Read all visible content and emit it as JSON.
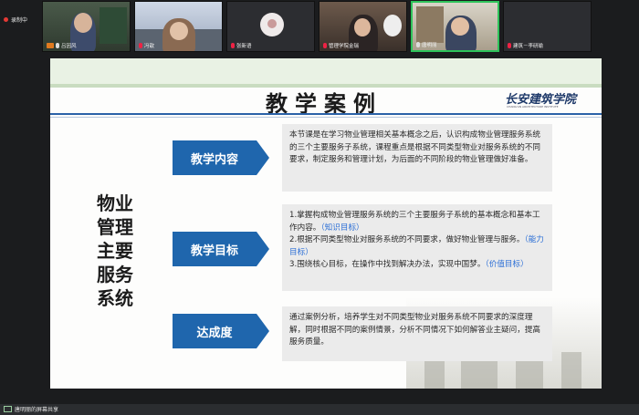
{
  "app": {
    "recording_label": "录制中",
    "screen_share_label": "唐明丽的屏幕共享"
  },
  "participants": [
    {
      "name": "吕因风",
      "mic": "on"
    },
    {
      "name": "冯歆",
      "mic": "muted"
    },
    {
      "name": "张新语",
      "mic": "muted"
    },
    {
      "name": "管理学院金瑞",
      "mic": "muted"
    },
    {
      "name": "唐明丽",
      "mic": "on",
      "active": true
    },
    {
      "name": "建筑－李研瑜",
      "mic": "muted"
    }
  ],
  "slide": {
    "title": "教学案例",
    "logo_text": "长安建筑学院",
    "logo_subtext": "CHANG'AN ARCHITECTURE INSTITUTE",
    "vertical_title": [
      "物业",
      "管理",
      "主要",
      "服务",
      "系统"
    ],
    "sections": [
      {
        "label": "教学内容",
        "text": "本节课是在学习物业管理相关基本概念之后，认识构成物业管理服务系统的三个主要服务子系统，课程重点是根据不同类型物业对服务系统的不同要求，制定服务和管理计划，为后面的不同阶段的物业管理做好准备。"
      },
      {
        "label": "教学目标",
        "goals": [
          {
            "text": "1.掌握构成物业管理服务系统的三个主要服务子系统的基本概念和基本工作内容。",
            "tag": "（知识目标）"
          },
          {
            "text": "2.根据不同类型物业对服务系统的不同要求，做好物业管理与服务。",
            "tag": "（能力目标）"
          },
          {
            "text": "3.围绕核心目标，在操作中找到解决办法，实现中国梦。",
            "tag": "（价值目标）"
          }
        ]
      },
      {
        "label": "达成度",
        "text": "通过案例分析，培养学生对不同类型物业对服务系统不同要求的深度理解，同时根据不同的案例情景，分析不同情况下如何解答业主疑问，提高服务质量。"
      }
    ]
  },
  "colors": {
    "arrow": "#1f66ad",
    "accent_blue": "#2c6fd6",
    "box_bg": "#ebebeb",
    "active_speaker": "#2ec35a"
  }
}
